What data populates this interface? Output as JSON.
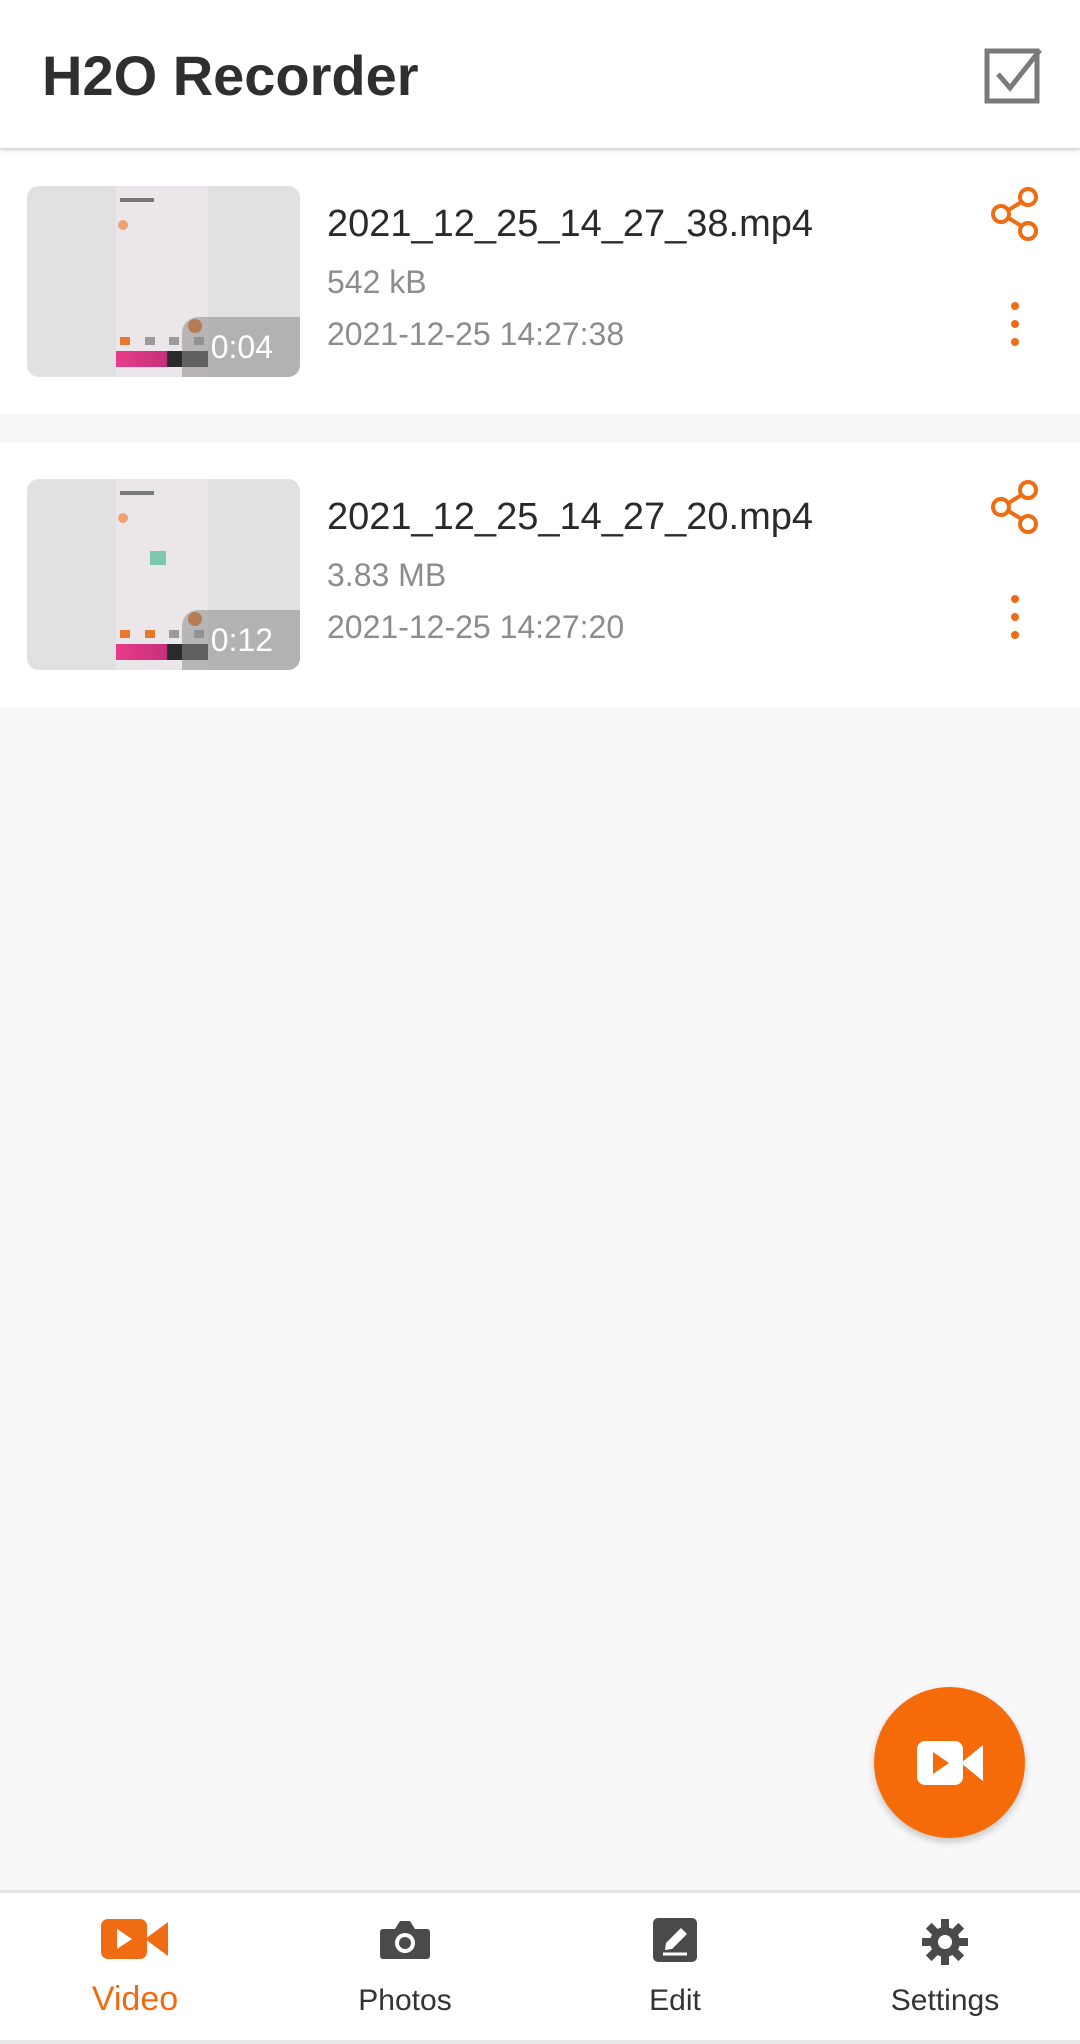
{
  "app": {
    "title": "H2O Recorder",
    "accent_color": "#f56b0a"
  },
  "header": {
    "select_icon": "checkbox-select-icon"
  },
  "recordings": [
    {
      "file_name": "2021_12_25_14_27_38.mp4",
      "size": "542 kB",
      "date": "2021-12-25 14:27:38",
      "duration": "0:04",
      "share_icon": "share-icon",
      "more_icon": "more-vert-icon"
    },
    {
      "file_name": "2021_12_25_14_27_20.mp4",
      "size": "3.83 MB",
      "date": "2021-12-25 14:27:20",
      "duration": "0:12",
      "share_icon": "share-icon",
      "more_icon": "more-vert-icon"
    }
  ],
  "fab": {
    "icon": "video-camera-icon"
  },
  "bottom_nav": {
    "items": [
      {
        "label": "Video",
        "icon": "video-camera-icon",
        "active": true
      },
      {
        "label": "Photos",
        "icon": "camera-icon",
        "active": false
      },
      {
        "label": "Edit",
        "icon": "edit-icon",
        "active": false
      },
      {
        "label": "Settings",
        "icon": "gear-icon",
        "active": false
      }
    ]
  }
}
